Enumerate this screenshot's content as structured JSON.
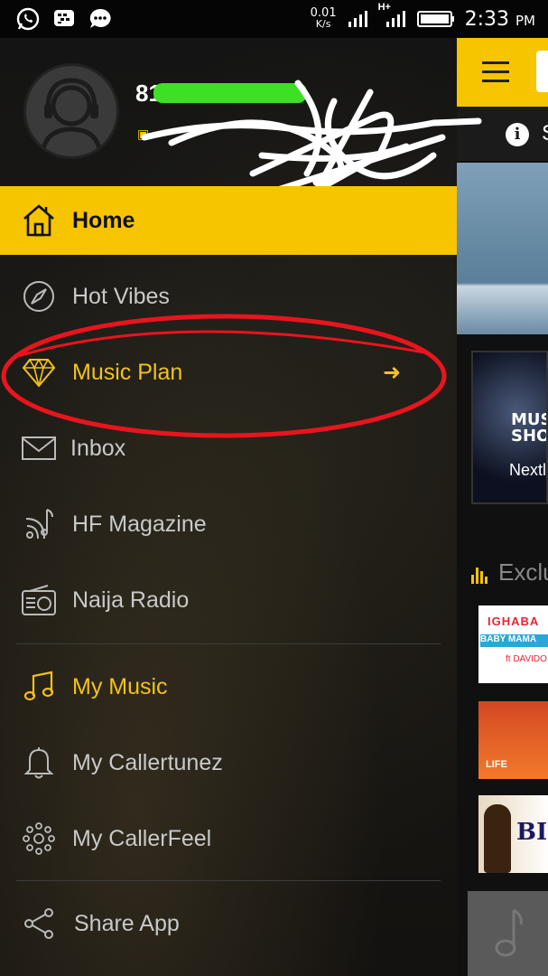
{
  "status_bar": {
    "net_speed_value": "0.01",
    "net_speed_unit": "K/s",
    "network_type": "H+",
    "time": "2:33",
    "ampm": "PM",
    "icons": [
      "whatsapp-icon",
      "bbm-icon",
      "chat-icon",
      "signal-icon",
      "signal-hplus-icon",
      "battery-icon"
    ]
  },
  "profile": {
    "msisdn_visible_prefix": "81",
    "avatar_icon": "headphone-user-icon"
  },
  "drawer": {
    "items": [
      {
        "label": "Home",
        "icon": "home-icon"
      },
      {
        "label": "Hot Vibes",
        "icon": "compass-icon"
      },
      {
        "label": "Music Plan",
        "icon": "diamond-icon",
        "trailing": "➜"
      },
      {
        "label": "Inbox",
        "icon": "mail-icon"
      },
      {
        "label": "HF Magazine",
        "icon": "broadcast-icon"
      },
      {
        "label": "Naija Radio",
        "icon": "radio-icon"
      },
      {
        "label": "My Music",
        "icon": "music-note-icon"
      },
      {
        "label": "My Callertunez",
        "icon": "bell-icon"
      },
      {
        "label": "My CallerFeel",
        "icon": "sparkle-icon"
      },
      {
        "label": "Share App",
        "icon": "share-icon"
      }
    ]
  },
  "background_screen": {
    "info_text_partial": "S",
    "card_title_partial": "MUS SHO",
    "card_caption_partial": "Nextl",
    "section_title_partial": "Exclu",
    "thumb1_text": "IGHABA",
    "thumb1_band": "BABY MAMA",
    "thumb1_artist": "ft DAVIDO",
    "thumb2_text": "LIFE",
    "thumb3_text": "BIG"
  },
  "colors": {
    "accent": "#f7c400",
    "annotation": "#e8141e",
    "redaction": "#3de024"
  }
}
